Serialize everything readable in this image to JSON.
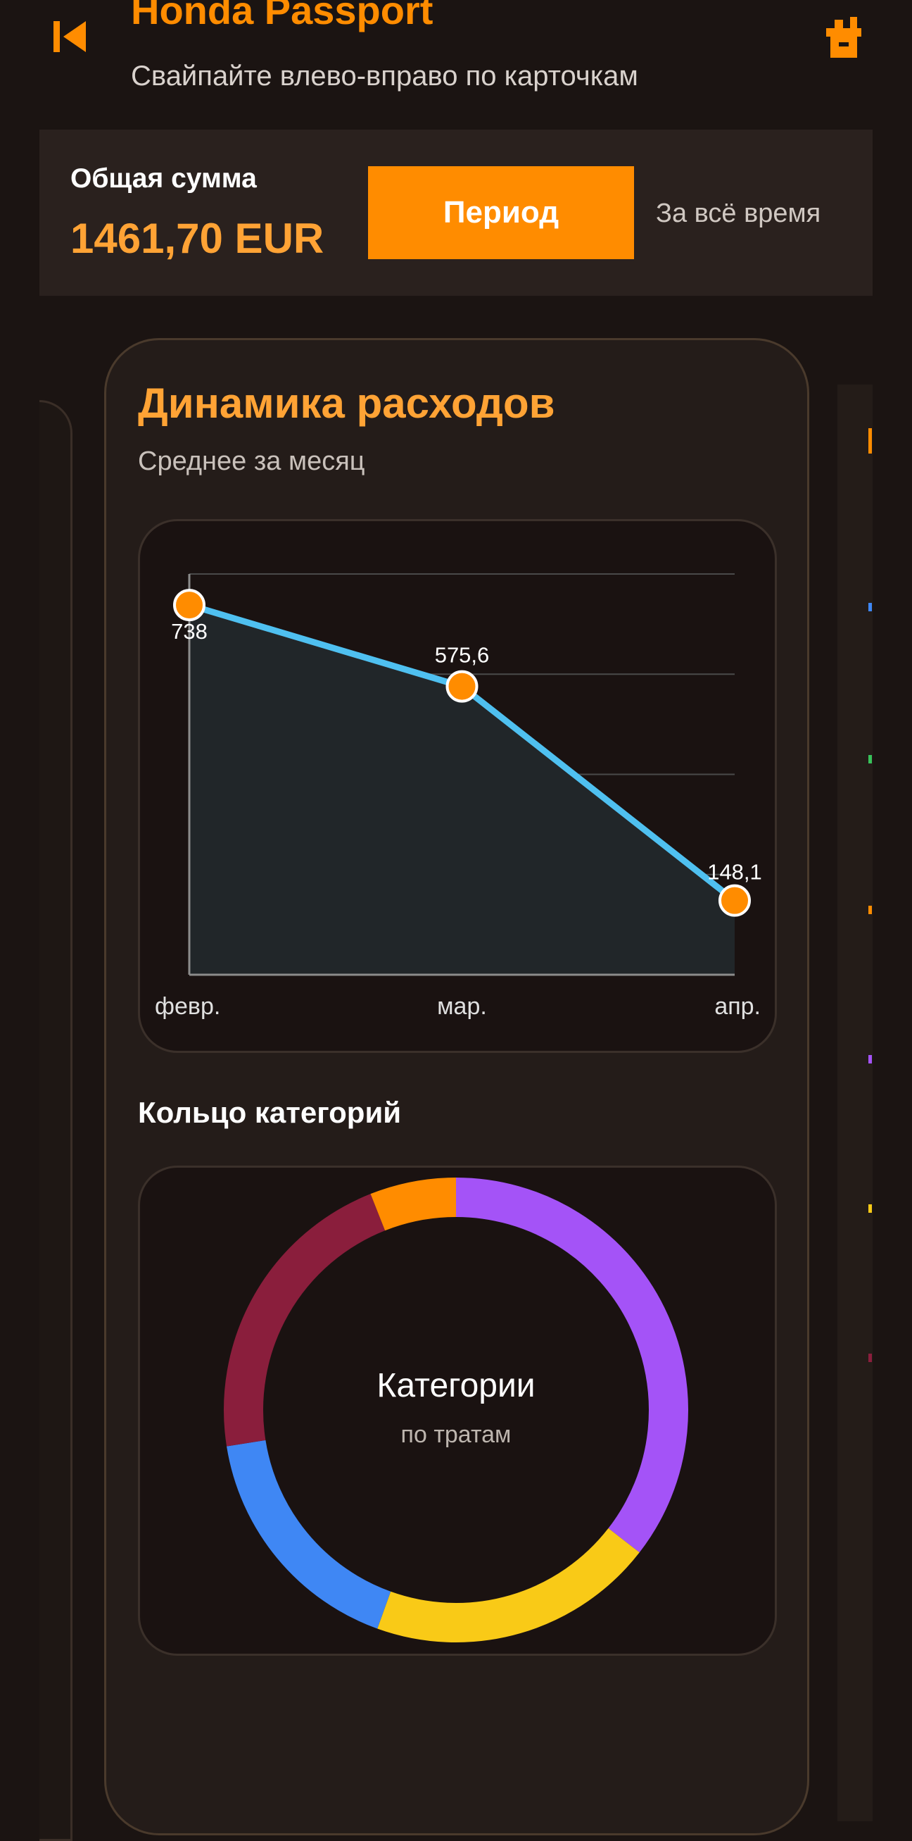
{
  "header": {
    "title": "Honda Passport",
    "subtitle": "Свайпайте влево-вправо по карточкам",
    "back_icon": "skip-back-icon",
    "toolbox_icon": "toolbox-icon",
    "accent_color": "#ff8c00"
  },
  "summary": {
    "total_label": "Общая сумма",
    "total_value": "1461,70 EUR",
    "period_button": "Период",
    "period_value": "За всё время"
  },
  "card": {
    "title": "Динамика расходов",
    "subtitle": "Среднее за месяц"
  },
  "chart_data": [
    {
      "type": "area",
      "title": "",
      "categories": [
        "февр.",
        "мар.",
        "апр."
      ],
      "series": [
        {
          "values": [
            738,
            575.6,
            148.1
          ],
          "color": "#4fc0f0"
        }
      ],
      "data_labels": [
        "738",
        "575,6",
        "148,1"
      ],
      "ylim": [
        0,
        800
      ],
      "grid": true,
      "point_color": "#ff8c00"
    },
    {
      "type": "pie",
      "style": "donut",
      "title": "Кольцо категорий",
      "center_title": "Категории",
      "center_subtitle": "по тратам",
      "slices": [
        {
          "value": 35.5,
          "color": "#a453f7"
        },
        {
          "value": 20.0,
          "color": "#f9ca17"
        },
        {
          "value": 17.0,
          "color": "#3f87f4"
        },
        {
          "value": 21.5,
          "color": "#8a1e3c"
        },
        {
          "value": 6.0,
          "color": "#ff8c00"
        }
      ]
    }
  ]
}
